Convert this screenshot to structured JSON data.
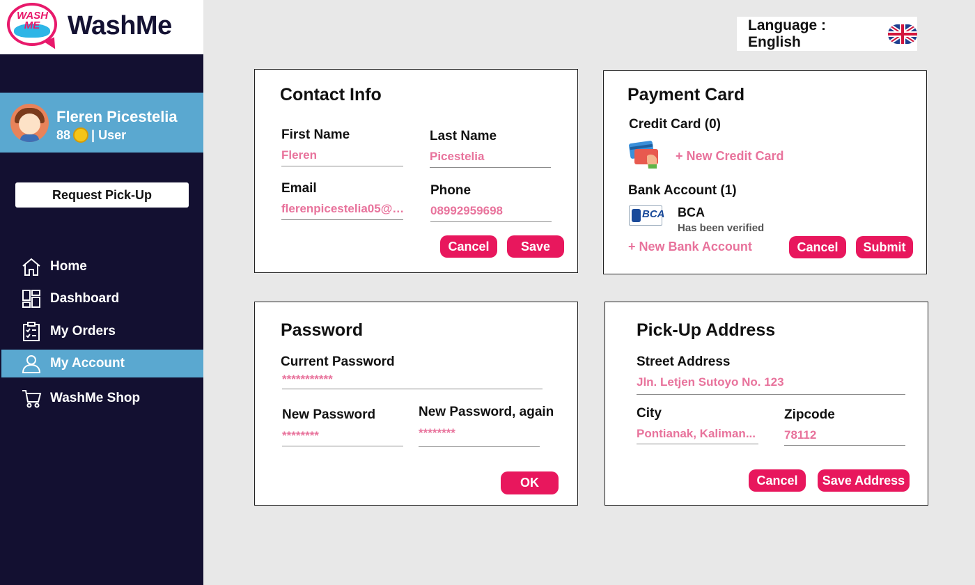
{
  "brand": {
    "name": "WashMe",
    "badge_text": "WASH ME"
  },
  "language": {
    "label": "Language : English"
  },
  "profile": {
    "name": "Fleren Picestelia",
    "coins": "88",
    "role": "| User"
  },
  "sidebar": {
    "pickup_label": "Request Pick-Up",
    "items": [
      {
        "label": "Home",
        "icon": "home-icon"
      },
      {
        "label": "Dashboard",
        "icon": "dashboard-icon"
      },
      {
        "label": "My Orders",
        "icon": "orders-icon"
      },
      {
        "label": "My Account",
        "icon": "user-icon"
      },
      {
        "label": "WashMe Shop",
        "icon": "cart-icon"
      }
    ]
  },
  "contact": {
    "title": "Contact Info",
    "first_name_label": "First Name",
    "first_name": "Fleren",
    "last_name_label": "Last Name",
    "last_name": "Picestelia",
    "email_label": "Email",
    "email": "flerenpicestelia05@g...",
    "phone_label": "Phone",
    "phone": "08992959698",
    "cancel": "Cancel",
    "save": "Save"
  },
  "payment": {
    "title": "Payment Card",
    "credit_label": "Credit Card (0)",
    "new_credit": "+ New Credit Card",
    "bank_label": "Bank Account (1)",
    "bank_logo": "BCA",
    "bank_name": "BCA",
    "bank_status": "Has been verified",
    "new_bank": "+ New Bank Account",
    "cancel": "Cancel",
    "submit": "Submit"
  },
  "password": {
    "title": "Password",
    "current_label": "Current Password",
    "current": "***********",
    "new_label": "New Password",
    "new": "********",
    "again_label": "New Password, again",
    "again": "********",
    "ok": "OK"
  },
  "address": {
    "title": "Pick-Up Address",
    "street_label": "Street Address",
    "street": "Jln. Letjen Sutoyo No. 123",
    "city_label": "City",
    "city": "Pontianak, Kaliman...",
    "zip_label": "Zipcode",
    "zip": "78112",
    "cancel": "Cancel",
    "save": "Save Address"
  },
  "colors": {
    "accent": "#e8175d",
    "sidebar": "#131031",
    "highlight": "#5aa8d0",
    "value_text": "#e8739c"
  }
}
